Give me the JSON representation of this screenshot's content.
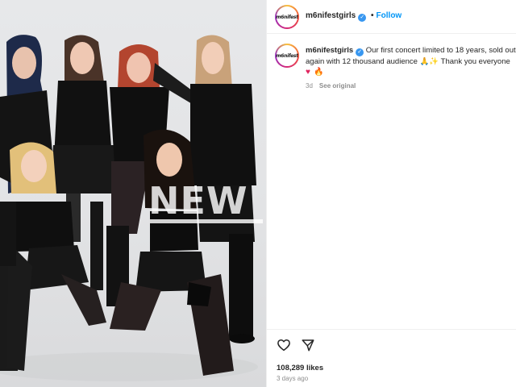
{
  "post": {
    "username": "m6nifestgirls",
    "follow_label": "Follow",
    "verified_mark": "✓",
    "avatar_text": "m6nifest",
    "caption_text": "Our first concert limited to 18 years, sold out",
    "caption_text_line2": "again with 12 thousand audience 🙏✨ Thank you everyone",
    "caption_emojis": [
      "♥",
      "🔥"
    ],
    "caption_age": "3d",
    "see_original_label": "See original",
    "likes": "108,289 likes",
    "timestamp": "3 days ago"
  },
  "image": {
    "watermark": "NEW"
  },
  "icons": {
    "like": "heart-outline-icon",
    "share": "paper-plane-icon",
    "verified": "verified-badge-icon"
  },
  "colors": {
    "accent": "#0095f6",
    "verified": "#3897f0",
    "text": "#262626",
    "muted": "#8e8e8e"
  }
}
